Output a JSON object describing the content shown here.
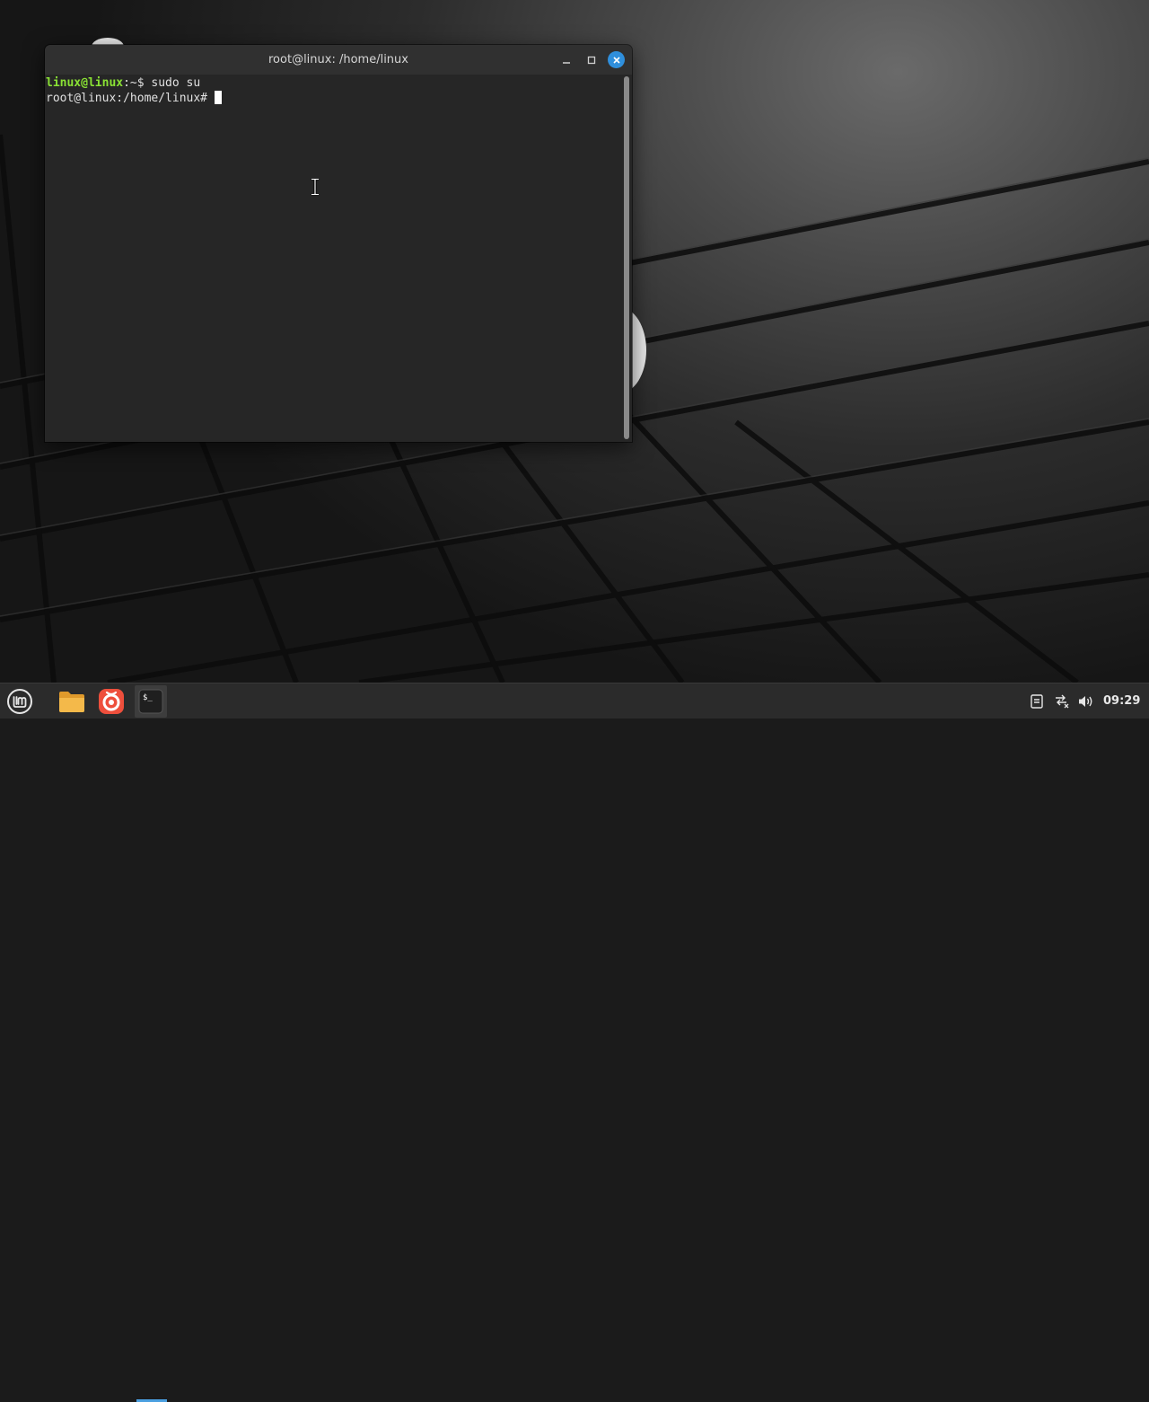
{
  "window": {
    "title": "root@linux: /home/linux"
  },
  "terminal": {
    "line1": {
      "user_host": "linux@linux",
      "path": ":~$",
      "command": " sudo su"
    },
    "line2": {
      "prompt": "root@linux:/home/linux#",
      "input": " "
    }
  },
  "taskbar": {
    "clock": "09:29",
    "items": [
      "menu-icon",
      "folder-icon",
      "browser-icon",
      "terminal-icon"
    ],
    "tray": [
      "clipboard-icon",
      "network-disconnected-icon",
      "volume-icon"
    ]
  },
  "colors": {
    "prompt_user": "#8ae234",
    "close_button": "#2f8fdc",
    "active_indicator": "#4a9fe0"
  }
}
